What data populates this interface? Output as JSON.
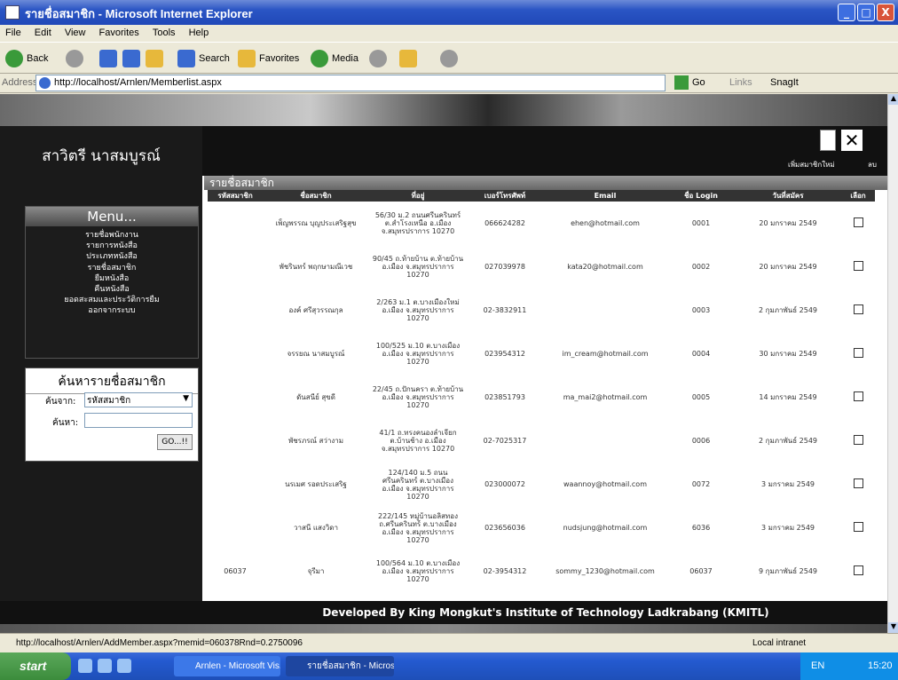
{
  "window": {
    "title": "รายชื่อสมาชิก - Microsoft Internet Explorer",
    "min": "_",
    "max": "□",
    "close": "X"
  },
  "menubar": [
    "File",
    "Edit",
    "View",
    "Favorites",
    "Tools",
    "Help"
  ],
  "toolbar": {
    "back": "Back",
    "search": "Search",
    "favorites": "Favorites",
    "media": "Media"
  },
  "addressbar": {
    "label": "Address",
    "url": "http://localhost/Arnlen/Memberlist.aspx",
    "go": "Go",
    "links": "Links",
    "snagit": "SnagIt"
  },
  "sidebar": {
    "user_name": "สาวิตรี นาสมบูรณ์",
    "menu_title": "Menu...",
    "menu_items": [
      "รายชื่อพนักงาน",
      "รายการหนังสือ",
      "ประเภทหนังสือ",
      "รายชื่อสมาชิก",
      "ยืมหนังสือ",
      "คืนหนังสือ",
      "ยอดสะสมและประวัติการยืม",
      "ออกจากระบบ"
    ],
    "search": {
      "title": "ค้นหารายชื่อสมาชิก",
      "find_by_label": "ค้นจาก:",
      "find_by_value": "รหัสสมาชิก",
      "keyword_label": "ค้นหา:",
      "keyword_value": "",
      "go_label": "GO...!!"
    }
  },
  "actions": {
    "new_label": "เพิ่มสมาชิกใหม่",
    "delete_label": "ลบ"
  },
  "member_table": {
    "title": "รายชื่อสมาชิก",
    "headers": [
      "รหัสสมาชิก",
      "ชื่อสมาชิก",
      "ที่อยู่",
      "เบอร์โทรศัพท์",
      "Email",
      "ชื่อ Login",
      "วันที่สมัคร",
      "เลือก"
    ],
    "rows": [
      {
        "id": "",
        "name": "เพ็ญพรรณ บุญประเสริฐสุข",
        "address": "56/30 ม.2 ถนนศรีนครินทร์ ต.สำโรงเหนือ อ.เมือง จ.สมุทรปราการ 10270",
        "phone": "066624282",
        "email": "ehen@hotmail.com",
        "login": "0001",
        "date": "20 มกราคม 2549"
      },
      {
        "id": "",
        "name": "พัชรินทร์ พฤกษามณีเวช",
        "address": "90/45 ถ.ท้ายบ้าน ต.ท้ายบ้าน อ.เมือง จ.สมุทรปราการ 10270",
        "phone": "027039978",
        "email": "kata20@hotmail.com",
        "login": "0002",
        "date": "20 มกราคม 2549"
      },
      {
        "id": "",
        "name": "องค์ ศรีสุวรรณกุล",
        "address": "2/263 ม.1 ต.บางเมืองใหม่ อ.เมือง จ.สมุทรปราการ 10270",
        "phone": "02-3832911",
        "email": "",
        "login": "0003",
        "date": "2 กุมภาพันธ์ 2549"
      },
      {
        "id": "",
        "name": "จรรยณ นาสมบูรณ์",
        "address": "100/525 ม.10 ต.บางเมือง อ.เมือง จ.สมุทรปราการ 10270",
        "phone": "023954312",
        "email": "im_cream@hotmail.com",
        "login": "0004",
        "date": "30 มกราคม 2549"
      },
      {
        "id": "",
        "name": "ดันสนีย์ สุขดี",
        "address": "22/45 ถ.ปักนครา ต.ท้ายบ้าน อ.เมือง จ.สมุทรปราการ 10270",
        "phone": "023851793",
        "email": "ma_mai2@hotmail.com",
        "login": "0005",
        "date": "14 มกราคม 2549"
      },
      {
        "id": "",
        "name": "พัชรภรณ์ สว่างาม",
        "address": "41/1 ถ.ทรงคนองลำเจียก ต.บ้านช้าง อ.เมือง จ.สมุทรปราการ 10270",
        "phone": "02-7025317",
        "email": "",
        "login": "0006",
        "date": "2 กุมภาพันธ์ 2549"
      },
      {
        "id": "",
        "name": "นรเมศ รอดประเสริฐ",
        "address": "124/140 ม.5 ถนนศรีนครินทร์ ต.บางเมือง อ.เมือง จ.สมุทรปราการ 10270",
        "phone": "023000072",
        "email": "waannoy@hotmail.com",
        "login": "0072",
        "date": "3 มกราคม 2549"
      },
      {
        "id": "",
        "name": "วาสนี แสงวิดา",
        "address": "222/145 หมู่บ้านอลิสทอง ถ.ศรีนครินทร์ ต.บางเมือง อ.เมือง จ.สมุทรปราการ 10270",
        "phone": "023656036",
        "email": "nudsjung@hotmail.com",
        "login": "6036",
        "date": "3 มกราคม 2549"
      },
      {
        "id": "06037",
        "name": "จุรีมา",
        "address": "100/564 ม.10 ต.บางเมือง อ.เมือง จ.สมุทรปราการ 10270",
        "phone": "02-3954312",
        "email": "sommy_1230@hotmail.com",
        "login": "06037",
        "date": "9 กุมภาพันธ์ 2549"
      }
    ]
  },
  "footer": "Developed By King Mongkut's Institute of Technology Ladkrabang (KMITL)",
  "statusbar": {
    "text": "http://localhost/Arnlen/AddMember.aspx?memid=060378Rnd=0.2750096",
    "zone": "Local intranet"
  },
  "taskbar": {
    "start": "start",
    "task1": "Arnlen - Microsoft Vis...",
    "task2": "รายชื่อสมาชิก - Micros...",
    "lang": "EN",
    "clock": "15:20"
  }
}
